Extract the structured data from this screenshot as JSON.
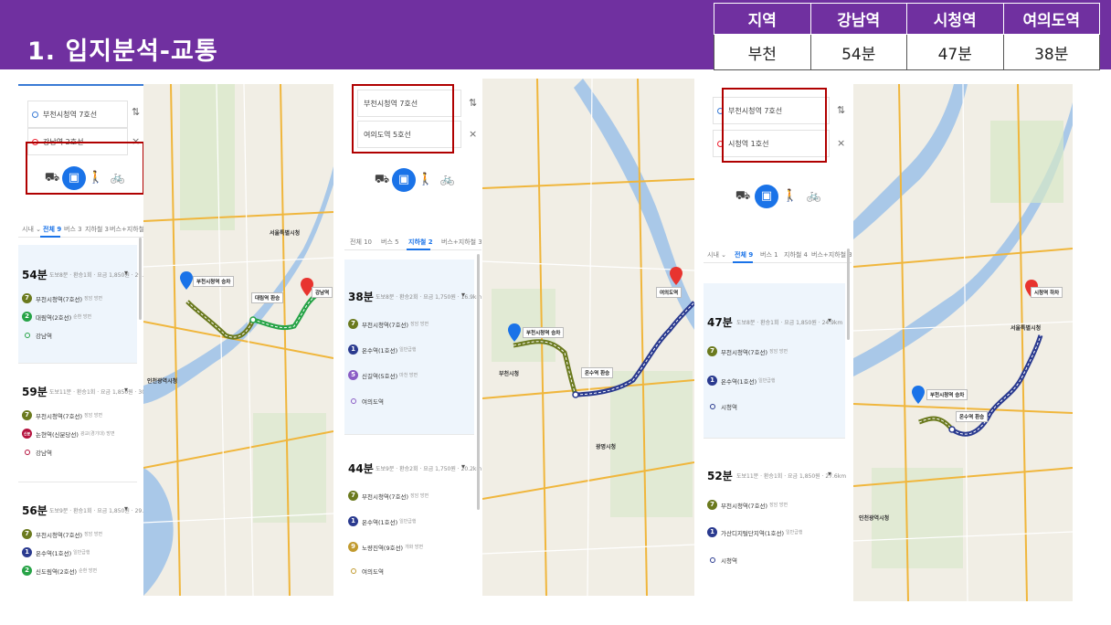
{
  "header": {
    "title": "1. 입지분석-교통",
    "table": {
      "headers": [
        "지역",
        "강남역",
        "시청역",
        "여의도역"
      ],
      "row": [
        "부천",
        "54분",
        "47분",
        "38분"
      ]
    }
  },
  "colors": {
    "header_bg": "#7030a0",
    "highlight_box": "#b00000",
    "active_blue": "#1a73e8",
    "line7": "#6b7a1e",
    "line2": "#27a347",
    "line1": "#2a3a8f",
    "line5": "#8a5cc5",
    "line9": "#c19a2e",
    "sinbundang": "#b5123e"
  },
  "panels": [
    {
      "origin": "부천시청역 7호선",
      "destination": "강남역 2호선",
      "tabs": [
        "전체 9",
        "버스 3",
        "지하철 3",
        "버스+지하철 3"
      ],
      "route_label_prefix": "시내 ⌄",
      "routes": [
        {
          "time": "54분",
          "info": "도보8분 · 환승1회 · 요금 1,850원 · 29.4km",
          "steps": [
            {
              "badge": "7",
              "name": "부천시청역(7호선)",
              "dir": "장암 방면"
            },
            {
              "badge": "2",
              "name": "대림역(2호선)",
              "dir": "순환 방면"
            }
          ],
          "end": "강남역"
        },
        {
          "time": "59분",
          "info": "도보11분 · 환승1회 · 요금 1,850원 · 30.3km",
          "steps": [
            {
              "badge": "7",
              "name": "부천시청역(7호선)",
              "dir": "장암 방면"
            },
            {
              "badge": "신분",
              "name": "논현역(신분당선)",
              "dir": "광교(경기대) 방면"
            }
          ],
          "end": "강남역"
        },
        {
          "time": "56분",
          "info": "도보9분 · 환승1회 · 요금 1,850원 · 29.1km",
          "steps": [
            {
              "badge": "7",
              "name": "부천시청역(7호선)",
              "dir": "장암 방면"
            },
            {
              "badge": "1",
              "name": "온수역(1호선)",
              "dir": "일반급행"
            },
            {
              "badge": "2",
              "name": "신도림역(2호선)",
              "dir": "순환 방면"
            }
          ],
          "end": ""
        }
      ],
      "map": {
        "start_label": "부천시청역 승차",
        "mid_label": "대림역 환승",
        "end_label": "강남역",
        "places": [
          "서울특별시청",
          "인천광역시청"
        ]
      }
    },
    {
      "origin": "부천시청역 7호선",
      "destination": "여의도역 5호선",
      "tabs": [
        "전체 10",
        "버스 5",
        "지하철 2",
        "버스+지하철 3"
      ],
      "routes": [
        {
          "time": "38분",
          "info": "도보8분 · 환승2회 · 요금 1,750원 · 16.9km",
          "steps": [
            {
              "badge": "7",
              "name": "부천시청역(7호선)",
              "dir": "장암 방면"
            },
            {
              "badge": "1",
              "name": "온수역(1호선)",
              "dir": "일반급행"
            },
            {
              "badge": "5",
              "name": "신길역(5호선)",
              "dir": "마천 방면"
            }
          ],
          "end": "여의도역"
        },
        {
          "time": "44분",
          "info": "도보9분 · 환승2회 · 요금 1,750원 · 20.2km",
          "steps": [
            {
              "badge": "7",
              "name": "부천시청역(7호선)",
              "dir": "장암 방면"
            },
            {
              "badge": "1",
              "name": "온수역(1호선)",
              "dir": "일반급행"
            },
            {
              "badge": "9",
              "name": "노량진역(9호선)",
              "dir": "개화 방면"
            }
          ],
          "end": "여의도역"
        }
      ],
      "map": {
        "start_label": "부천시청역 승차",
        "mid_label": "온수역 환승",
        "end_label": "여의도역",
        "places": [
          "광명시청",
          "부천시청"
        ]
      }
    },
    {
      "origin": "부천시청역 7호선",
      "destination": "시청역 1호선",
      "tabs": [
        "전체 9",
        "버스 1",
        "지하철 4",
        "버스+지하철 3"
      ],
      "route_label_prefix": "시내 ⌄",
      "routes": [
        {
          "time": "47분",
          "info": "도보8분 · 환승1회 · 요금 1,850원 · 24.9km",
          "steps": [
            {
              "badge": "7",
              "name": "부천시청역(7호선)",
              "dir": "장암 방면"
            },
            {
              "badge": "1",
              "name": "온수역(1호선)",
              "dir": "일반급행"
            }
          ],
          "end": "시청역"
        },
        {
          "time": "52분",
          "info": "도보11분 · 환승1회 · 요금 1,850원 · 27.6km",
          "steps": [
            {
              "badge": "7",
              "name": "부천시청역(7호선)",
              "dir": "장암 방면"
            },
            {
              "badge": "1",
              "name": "가산디지털단지역(1호선)",
              "dir": "일반급행"
            }
          ],
          "end": "시청역"
        }
      ],
      "map": {
        "start_label": "부천시청역 승차",
        "mid_label": "온수역 환승",
        "end_label": "시청역 하차",
        "places": [
          "서울특별시청",
          "인천광역시청"
        ]
      }
    }
  ]
}
